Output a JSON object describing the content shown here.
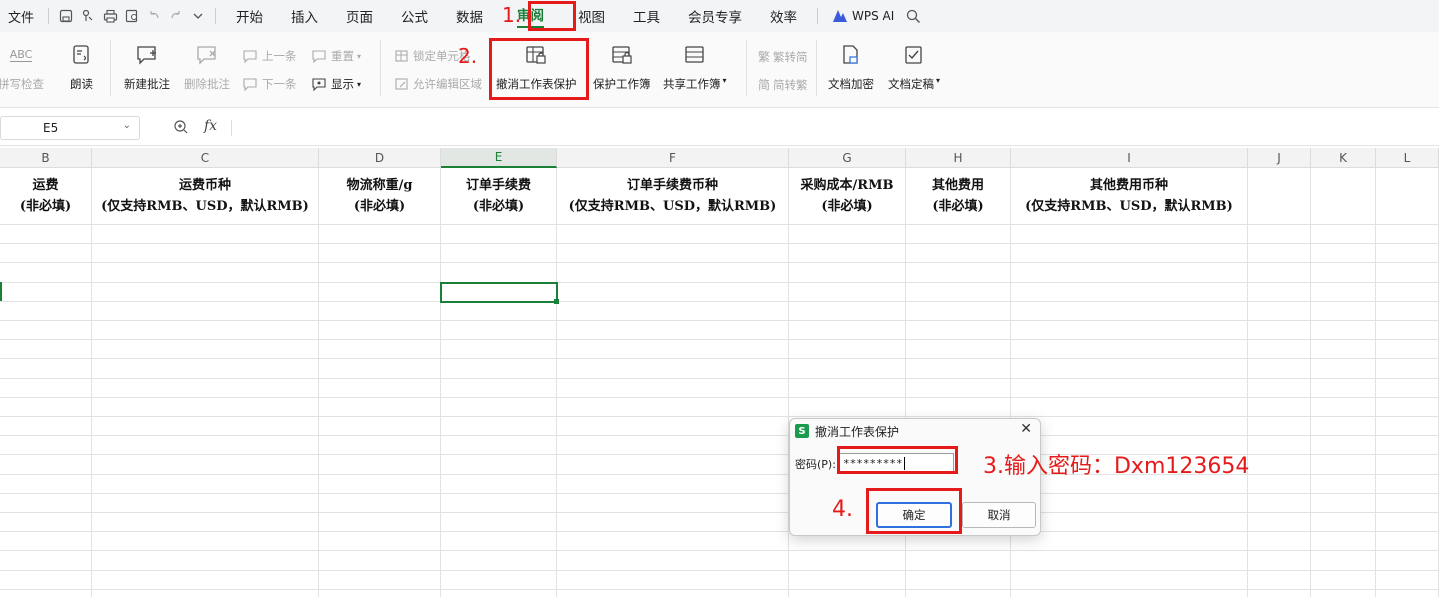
{
  "menubar": {
    "file": "文件",
    "tabs": [
      "开始",
      "插入",
      "页面",
      "公式",
      "数据",
      "审阅",
      "视图",
      "工具",
      "会员专享",
      "效率"
    ],
    "active_tab": "审阅",
    "wps_ai": "WPS AI"
  },
  "ribbon": {
    "spellcheck": "拼写检查",
    "read_aloud": "朗读",
    "new_comment": "新建批注",
    "delete_comment": "删除批注",
    "prev": "上一条",
    "next": "下一条",
    "reset": "重置",
    "show": "显示",
    "lock_cell": "锁定单元格",
    "allow_edit_range": "允许编辑区域",
    "unprotect_sheet": "撤消工作表保护",
    "protect_workbook": "保护工作簿",
    "share_workbook": "共享工作簿",
    "to_simplified": "繁转简",
    "to_traditional": "简转繁",
    "doc_encrypt": "文档加密",
    "doc_finalize": "文档定稿",
    "abc_icon_text": "ABC"
  },
  "formula_bar": {
    "name_box": "E5",
    "fx": "fx",
    "value": ""
  },
  "sheet": {
    "col_headers": [
      "B",
      "C",
      "D",
      "E",
      "F",
      "G",
      "H",
      "I",
      "J",
      "K",
      "L"
    ],
    "selected_col": "E",
    "selected_cell": "E5",
    "header_row": [
      {
        "line1": "运费",
        "line2": "(非必填)"
      },
      {
        "line1": "运费币种",
        "line2": "(仅支持RMB、USD，默认RMB)"
      },
      {
        "line1": "物流称重/g",
        "line2": "(非必填)"
      },
      {
        "line1": "订单手续费",
        "line2": "(非必填)"
      },
      {
        "line1": "订单手续费币种",
        "line2": "(仅支持RMB、USD，默认RMB)"
      },
      {
        "line1": "采购成本/RMB",
        "line2": "(非必填)"
      },
      {
        "line1": "其他费用",
        "line2": "(非必填)"
      },
      {
        "line1": "其他费用币种",
        "line2": "(仅支持RMB、USD，默认RMB)"
      },
      {
        "line1": "",
        "line2": ""
      },
      {
        "line1": "",
        "line2": ""
      },
      {
        "line1": "",
        "line2": ""
      }
    ]
  },
  "dialog": {
    "title": "撤消工作表保护",
    "logo": "S",
    "password_label": "密码(P):",
    "password_value": "*********",
    "ok": "确定",
    "cancel": "取消"
  },
  "annotations": {
    "step1": "1.",
    "step2": "2.",
    "step3": "3.输入密码：Dxm123654",
    "step4": "4."
  },
  "colors": {
    "accent": "#1a7f37",
    "annotation": "#e51b1b",
    "primary_button": "#2f6fe0"
  }
}
